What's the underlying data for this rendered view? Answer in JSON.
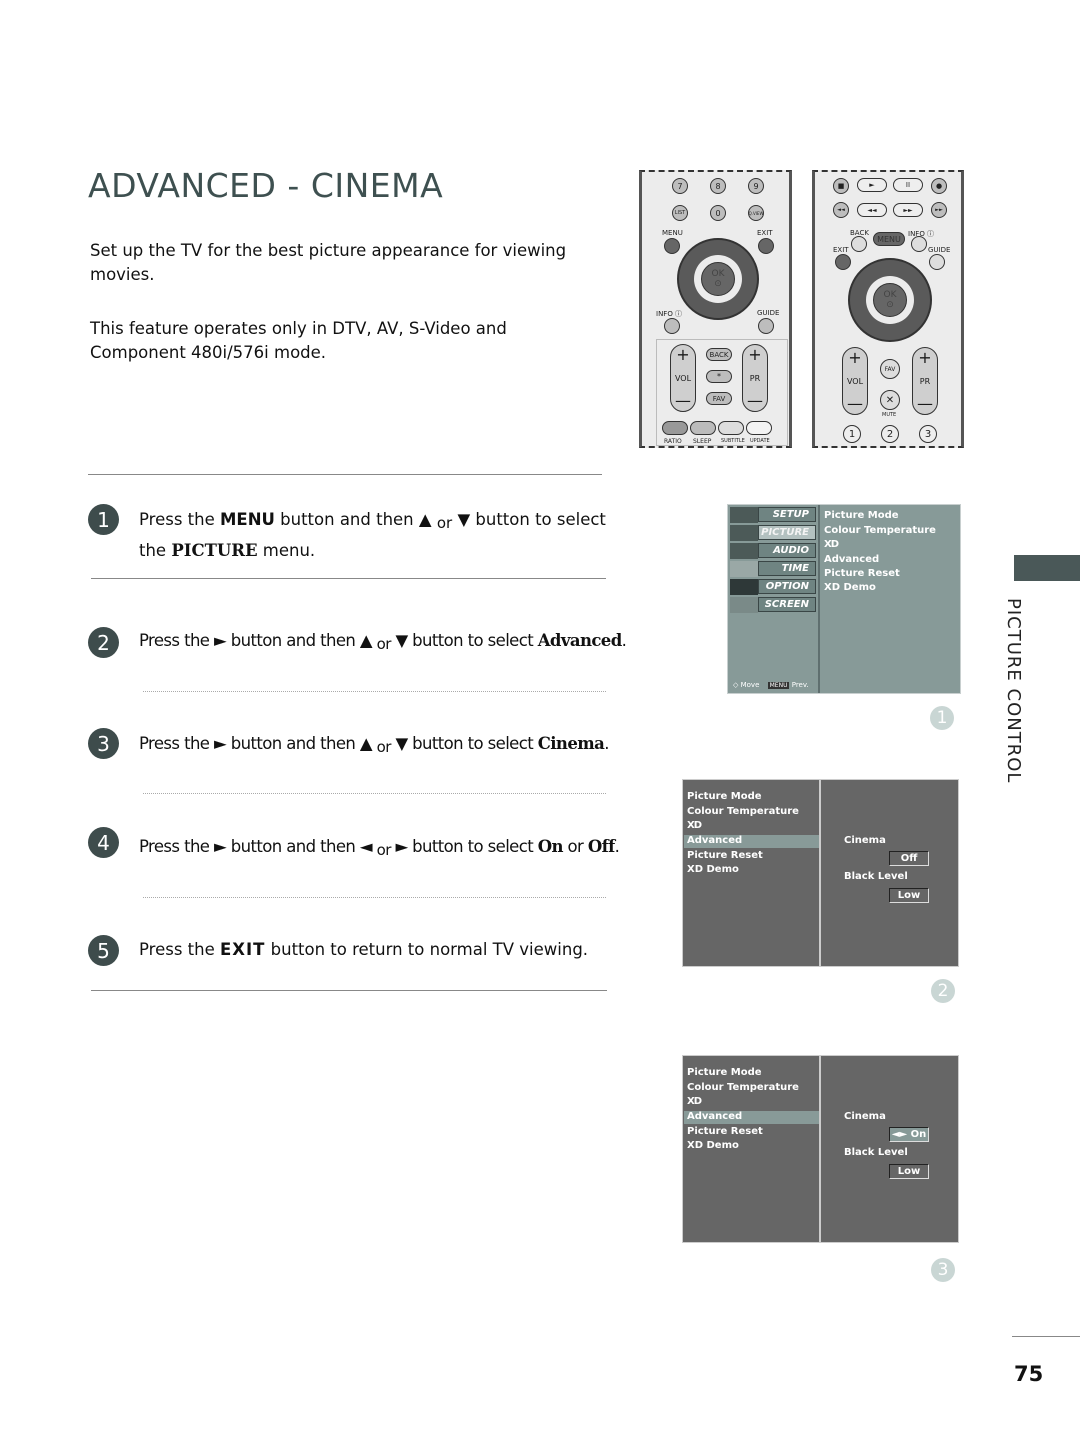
{
  "page": {
    "title": "ADVANCED - CINEMA",
    "intro_1": "Set up the TV for the best picture appearance for viewing movies.",
    "intro_2": "This feature operates only in DTV, AV, S-Video and Component 480i/576i mode.",
    "section_tab": "PICTURE CONTROL",
    "page_number": "75",
    "accent_color": "#3e4c4c"
  },
  "steps": [
    {
      "num": "1",
      "pre": "Press the ",
      "key": "MENU",
      "mid": " button and then ",
      "up": "▲",
      "or": "or",
      "down": "▼",
      "post": " button to select",
      "line2_pre": "the ",
      "target": "PICTURE",
      "line2_post": " menu."
    },
    {
      "num": "2",
      "pre": "Press the ",
      "arrow": "►",
      "mid": " button and then ",
      "a1": "▲",
      "or": "or",
      "a2": "▼",
      "post": " button to select ",
      "target": "Advanced",
      "end": "."
    },
    {
      "num": "3",
      "pre": "Press the ",
      "arrow": "►",
      "mid": " button and then ",
      "a1": "▲",
      "or": "or",
      "a2": "▼",
      "post": " button to select ",
      "target": "Cinema",
      "end": "."
    },
    {
      "num": "4",
      "pre": "Press the ",
      "arrow": "►",
      "mid": " button and then ",
      "a1": "◄",
      "or": "or",
      "a2": "►",
      "post": " button to select ",
      "target": "On",
      "or2": " or ",
      "target2": "Off",
      "end": "."
    },
    {
      "num": "5",
      "pre": "Press the ",
      "key": "EXIT",
      "post": " button to return to normal TV viewing."
    }
  ],
  "remote_a": {
    "row1": [
      "7",
      "8",
      "9"
    ],
    "row2": [
      "LIST",
      "0",
      "Q.VIEW"
    ],
    "menu": "MENU",
    "exit": "EXIT",
    "ok": "OK",
    "info": "INFO ⓘ",
    "guide": "GUIDE",
    "vol": "VOL",
    "pr": "PR",
    "back": "BACK",
    "star": "*",
    "fav": "FAV",
    "plus": "+",
    "minus": "—",
    "colour_keys": [
      "RATIO",
      "SLEEP",
      "SUBTITLE",
      "UPDATE"
    ]
  },
  "remote_b": {
    "transport_1": [
      "■",
      "►",
      "II",
      "●"
    ],
    "transport_2": [
      "◄◄",
      "◄◄",
      "►►",
      "►►"
    ],
    "back": "BACK",
    "menu": "MENU",
    "info": "INFO ⓘ",
    "exit": "EXIT",
    "guide": "GUIDE",
    "ok": "OK",
    "vol": "VOL",
    "pr": "PR",
    "fav": "FAV",
    "mute": "MUTE",
    "mute_icon": "✕",
    "plus": "+",
    "minus": "—",
    "row_nums": [
      "1",
      "2",
      "3"
    ]
  },
  "osd_1": {
    "tabs": [
      "SETUP",
      "PICTURE",
      "AUDIO",
      "TIME",
      "OPTION",
      "SCREEN"
    ],
    "active_tab": "PICTURE",
    "items": [
      "Picture Mode",
      "Colour Temperature",
      "XD",
      "Advanced",
      "Picture Reset",
      "XD Demo"
    ],
    "footer_move": "◇ Move",
    "footer_menu_key": "MENU",
    "footer_prev": "Prev.",
    "figure": "1"
  },
  "osd_2": {
    "items": [
      "Picture Mode",
      "Colour Temperature",
      "XD",
      "Advanced",
      "Picture Reset",
      "XD Demo"
    ],
    "selected": "Advanced",
    "cinema_label": "Cinema",
    "cinema_value": "Off",
    "black_level_label": "Black Level",
    "black_level_value": "Low",
    "figure": "2"
  },
  "osd_3": {
    "items": [
      "Picture Mode",
      "Colour Temperature",
      "XD",
      "Advanced",
      "Picture Reset",
      "XD Demo"
    ],
    "selected": "Advanced",
    "cinema_label": "Cinema",
    "cinema_value": "◄► On",
    "black_level_label": "Black Level",
    "black_level_value": "Low",
    "figure": "3"
  }
}
